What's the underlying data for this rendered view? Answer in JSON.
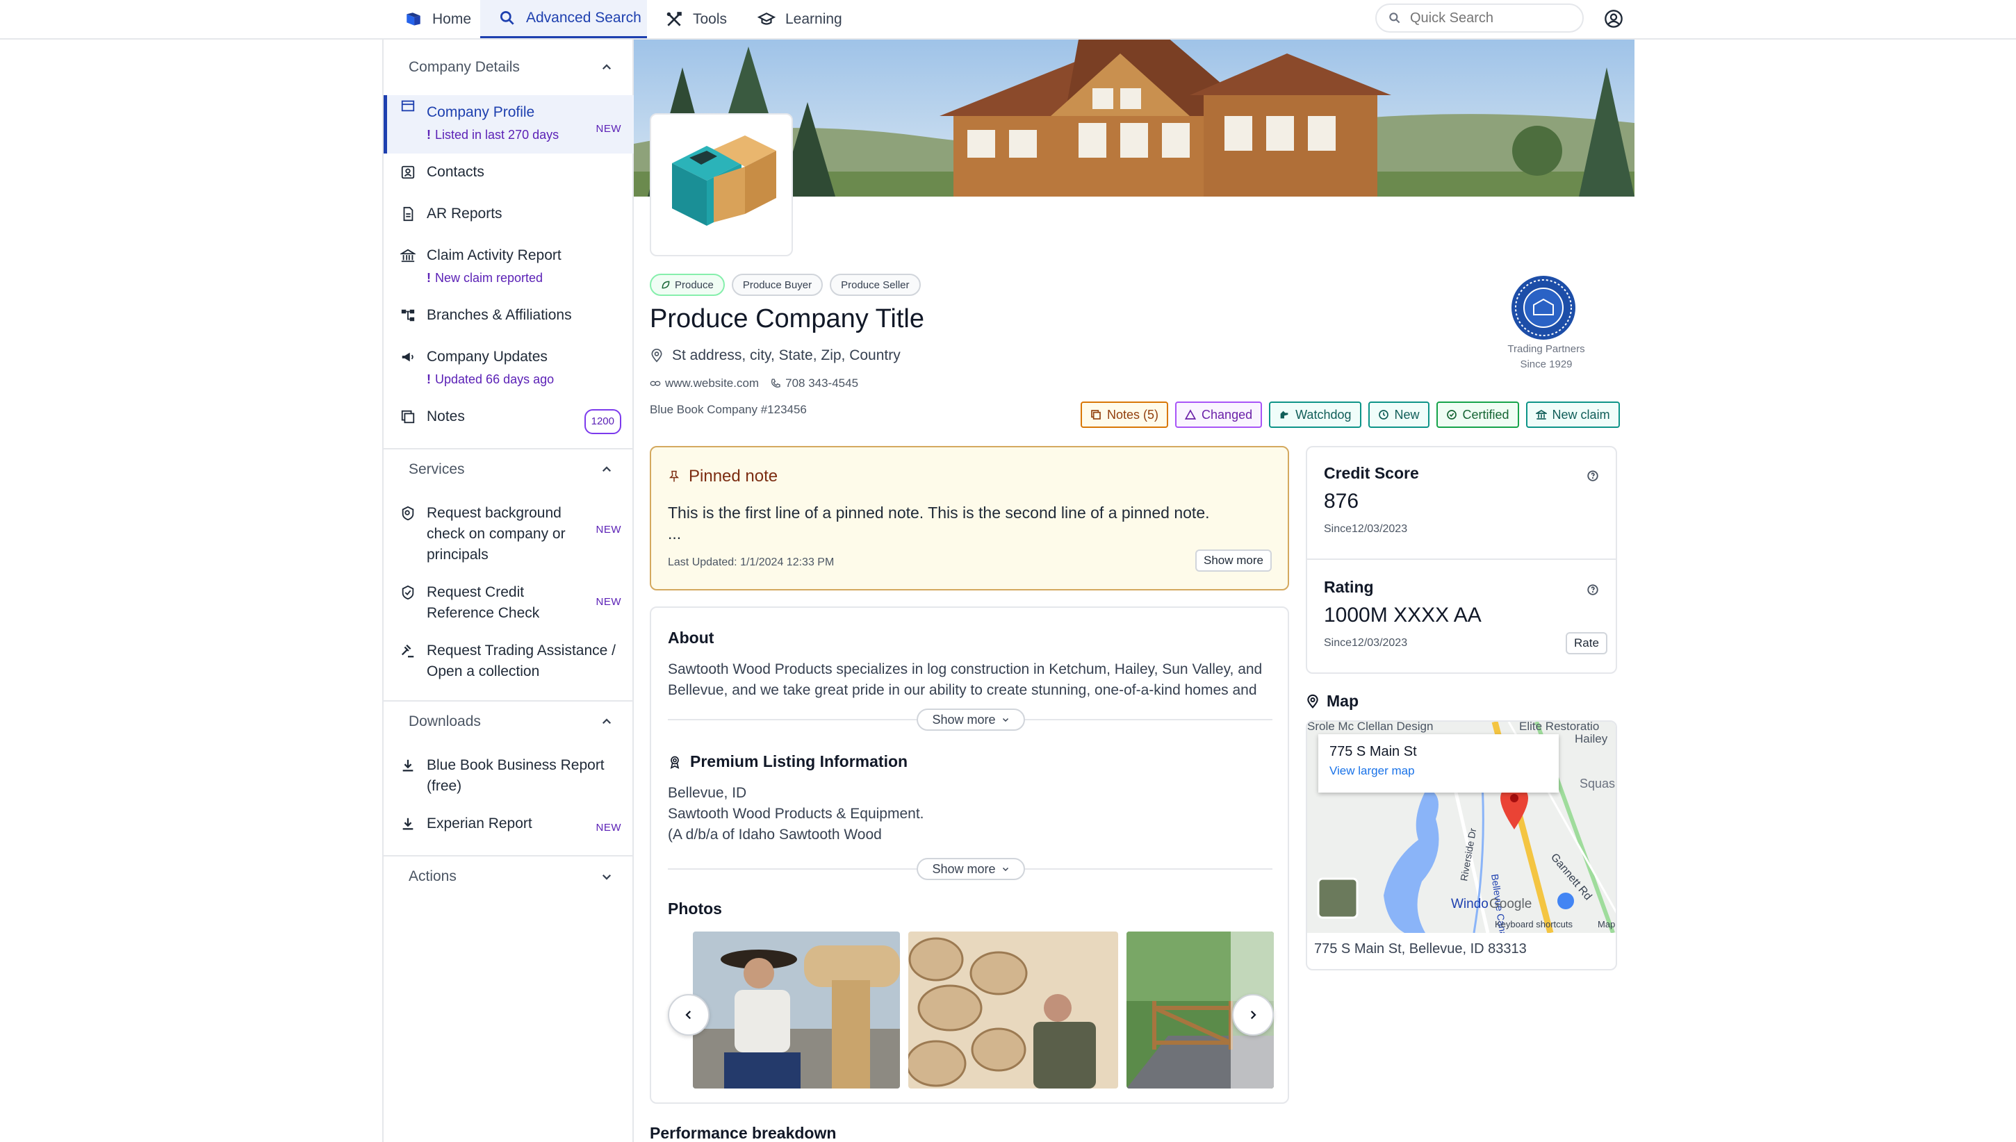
{
  "nav": {
    "items": [
      {
        "label": "Home",
        "icon": "book-icon"
      },
      {
        "label": "Advanced Search",
        "icon": "search-icon"
      },
      {
        "label": "Tools",
        "icon": "tools-icon"
      },
      {
        "label": "Learning",
        "icon": "graduation-cap-icon"
      }
    ],
    "active": "Advanced Search",
    "search_placeholder": "Quick Search"
  },
  "sidebar": {
    "company_details": {
      "heading": "Company Details",
      "items": [
        {
          "label": "Company Profile",
          "sub": "Listed in last 270 days",
          "badge": "NEW"
        },
        {
          "label": "Contacts"
        },
        {
          "label": "AR Reports"
        },
        {
          "label": "Claim Activity Report",
          "sub": "New claim reported"
        },
        {
          "label": "Branches & Affiliations"
        },
        {
          "label": "Company Updates",
          "sub": "Updated 66 days ago"
        },
        {
          "label": "Notes",
          "badge": "1200"
        }
      ]
    },
    "services": {
      "heading": "Services",
      "items": [
        {
          "label": "Request background check on company or principals",
          "badge": "NEW"
        },
        {
          "label": "Request Credit Reference Check",
          "badge": "NEW"
        },
        {
          "label": "Request Trading Assistance / Open a collection"
        }
      ]
    },
    "downloads": {
      "heading": "Downloads",
      "items": [
        {
          "label": "Blue Book Business Report (free)"
        },
        {
          "label": "Experian Report",
          "badge": "NEW"
        }
      ]
    },
    "actions": {
      "heading": "Actions"
    }
  },
  "company": {
    "tags": [
      "Produce",
      "Produce Buyer",
      "Produce Seller"
    ],
    "title": "Produce Company Title",
    "address": "St address, city, State, Zip, Country",
    "website": "www.website.com",
    "phone": "708 343-4545",
    "bb_number": "Blue Book Company #123456",
    "seal_line1": "Trading Partners",
    "seal_line2": "Since 1929",
    "status_badges": {
      "notes": "Notes (5)",
      "changed": "Changed",
      "watchdog": "Watchdog",
      "new": "New",
      "certified": "Certified",
      "new_claim": "New claim"
    }
  },
  "pinned_note": {
    "heading": "Pinned note",
    "line1": "This is the first line of a pinned note. This is the second line of a pinned note.",
    "ellipsis": "...",
    "updated": "Last Updated: 1/1/2024 12:33 PM",
    "show_more": "Show more"
  },
  "about": {
    "heading": "About",
    "text": "Sawtooth Wood Products specializes in log construction in Ketchum, Hailey, Sun Valley, and Bellevue, and we take great pride in our ability to create stunning, one-of-a-kind homes and",
    "show_more": "Show more"
  },
  "premium": {
    "heading": "Premium Listing Information",
    "line1": "Bellevue, ID",
    "line2": "Sawtooth Wood Products & Equipment.",
    "line3": "(A d/b/a of Idaho Sawtooth Wood",
    "show_more": "Show more"
  },
  "photos": {
    "heading": "Photos"
  },
  "performance": {
    "heading": "Performance breakdown"
  },
  "credit": {
    "label": "Credit Score",
    "value": "876",
    "since": "Since12/03/2023"
  },
  "rating": {
    "label": "Rating",
    "value": "1000M XXXX AA",
    "since": "Since12/03/2023",
    "rate_button": "Rate"
  },
  "map": {
    "heading": "Map",
    "popup_title": "775 S Main St",
    "popup_link": "View larger map",
    "address": "775 S Main St, Bellevue, ID 83313",
    "labels": {
      "top_left": "Srole Mc Clellan Design",
      "top_right": "Elite Restoratio",
      "hailey": "Hailey",
      "squas": "Squas",
      "riverside": "Riverside Dr",
      "canal": "Bellevue Canal",
      "gannett": "Gannett Rd",
      "window": "Windo",
      "google": "Google",
      "keyboard": "Keyboard shortcuts",
      "map_word": "Map"
    }
  }
}
